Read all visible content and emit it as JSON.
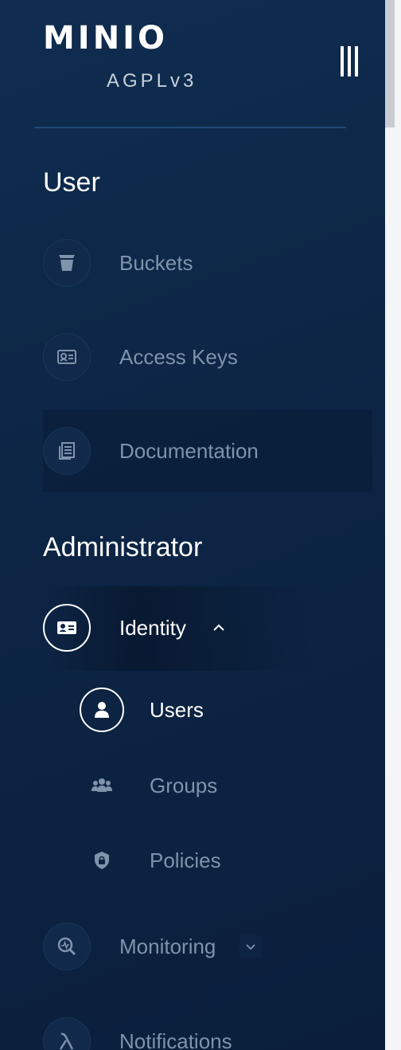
{
  "logo": {
    "wordmark": "MINIO",
    "license": "AGPLv3"
  },
  "sections": {
    "user": "User",
    "administrator": "Administrator"
  },
  "menu": {
    "buckets": "Buckets",
    "access_keys": "Access Keys",
    "documentation": "Documentation",
    "identity": "Identity",
    "monitoring": "Monitoring",
    "notifications": "Notifications"
  },
  "identity_sub": {
    "users": "Users",
    "groups": "Groups",
    "policies": "Policies"
  },
  "colors": {
    "sidebar_bg": "#0d2545",
    "active_text": "#ffffff",
    "inactive_text": "#7f93ab"
  },
  "icons": {
    "buckets": "bucket-icon",
    "access_keys": "id-card-icon",
    "documentation": "document-icon",
    "identity": "identity-card-icon",
    "users": "user-icon",
    "groups": "group-icon",
    "policies": "shield-lock-icon",
    "monitoring": "monitoring-search-icon",
    "notifications": "lambda-icon",
    "menu_toggle": "hamburger-icon"
  }
}
